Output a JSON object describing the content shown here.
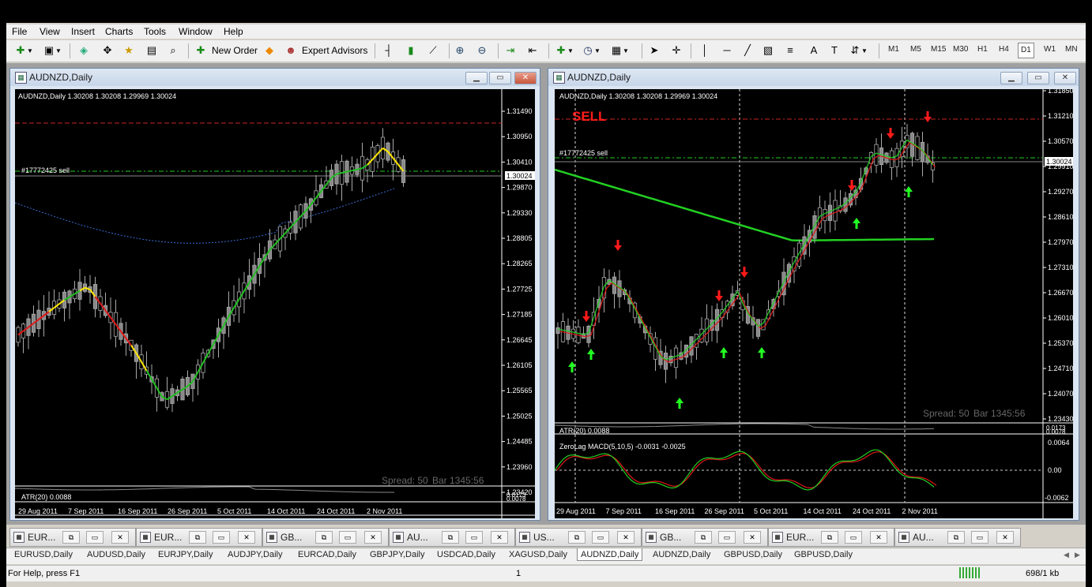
{
  "menu": [
    "File",
    "View",
    "Insert",
    "Charts",
    "Tools",
    "Window",
    "Help"
  ],
  "toolbar": {
    "new_order": "New Order",
    "expert_advisors": "Expert Advisors",
    "timeframes": [
      "M1",
      "M5",
      "M15",
      "M30",
      "H1",
      "H4",
      "D1",
      "W1",
      "MN"
    ],
    "selected_timeframe": "D1"
  },
  "left_window": {
    "title": "AUDNZD,Daily",
    "info": "AUDNZD,Daily  1.30208 1.30208 1.29969 1.30024",
    "order_label": "#17772425 sell",
    "price_tag": "1.30024",
    "spread": "Spread: 50",
    "bar": "Bar  1345:56",
    "atr": "ATR(20) 0.0088",
    "atr_levels": [
      "0.0173",
      "0.0078"
    ],
    "price_axis": [
      "1.31490",
      "1.30950",
      "1.30410",
      "1.29870",
      "1.29330",
      "1.28805",
      "1.28265",
      "1.27725",
      "1.27185",
      "1.26645",
      "1.26105",
      "1.25565",
      "1.25025",
      "1.24485",
      "1.23960",
      "1.23420"
    ],
    "dates": [
      "29 Aug 2011",
      "7 Sep 2011",
      "16 Sep 2011",
      "26 Sep 2011",
      "5 Oct 2011",
      "14 Oct 2011",
      "24 Oct 2011",
      "2 Nov 2011"
    ]
  },
  "right_window": {
    "title": "AUDNZD,Daily",
    "info": "AUDNZD,Daily  1.30208 1.30208 1.29969 1.30024",
    "sell_label": "SELL",
    "order_label": "#17772425 sell",
    "price_tag": "1.30024",
    "spread": "Spread: 50",
    "bar": "Bar  1345:56",
    "atr": "ATR(20) 0.0088",
    "atr_levels": [
      "0.0173",
      "0.0078"
    ],
    "macd": "ZeroLag MACD(5,10,5) -0.0031 -0.0025",
    "macd_axis": [
      "0.0064",
      "0.00",
      "-0.0062"
    ],
    "price_axis": [
      "1.31850",
      "1.31210",
      "1.30570",
      "1.29910",
      "1.29270",
      "1.28610",
      "1.27970",
      "1.27310",
      "1.26670",
      "1.26010",
      "1.25370",
      "1.24710",
      "1.24070",
      "1.23430"
    ],
    "dates": [
      "29 Aug 2011",
      "7 Sep 2011",
      "16 Sep 2011",
      "26 Sep 2011",
      "5 Oct 2011",
      "14 Oct 2011",
      "24 Oct 2011",
      "2 Nov 2011"
    ]
  },
  "window_tabs": [
    "EUR...",
    "EUR...",
    "GB...",
    "AU...",
    "US...",
    "GB...",
    "EUR...",
    "AU..."
  ],
  "symbol_tabs": [
    "EURUSD,Daily",
    "AUDUSD,Daily",
    "EURJPY,Daily",
    "AUDJPY,Daily",
    "EURCAD,Daily",
    "GBPJPY,Daily",
    "USDCAD,Daily",
    "XAGUSD,Daily",
    "AUDNZD,Daily",
    "AUDNZD,Daily",
    "GBPUSD,Daily",
    "GBPUSD,Daily"
  ],
  "active_symbol_tab": 8,
  "status": {
    "help": "For Help, press F1",
    "page": "1",
    "traffic": "698/1 kb"
  }
}
